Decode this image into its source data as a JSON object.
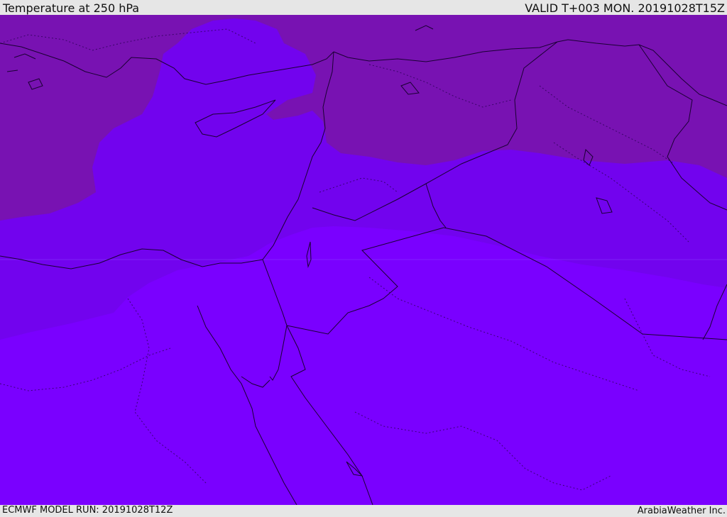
{
  "header": {
    "title": "Temperature at 250 hPa",
    "valid": "VALID T+003 MON. 20191028T15Z"
  },
  "footer": {
    "model_run": "ECMWF MODEL RUN: 20191028T12Z",
    "credit": "ArabiaWeather Inc."
  },
  "colors": {
    "warm_band": "#7a00ff",
    "mid_band": "#7000ee",
    "cool_band": "#7812b2",
    "border": "#1a0033",
    "background": "#e6e6e6"
  }
}
